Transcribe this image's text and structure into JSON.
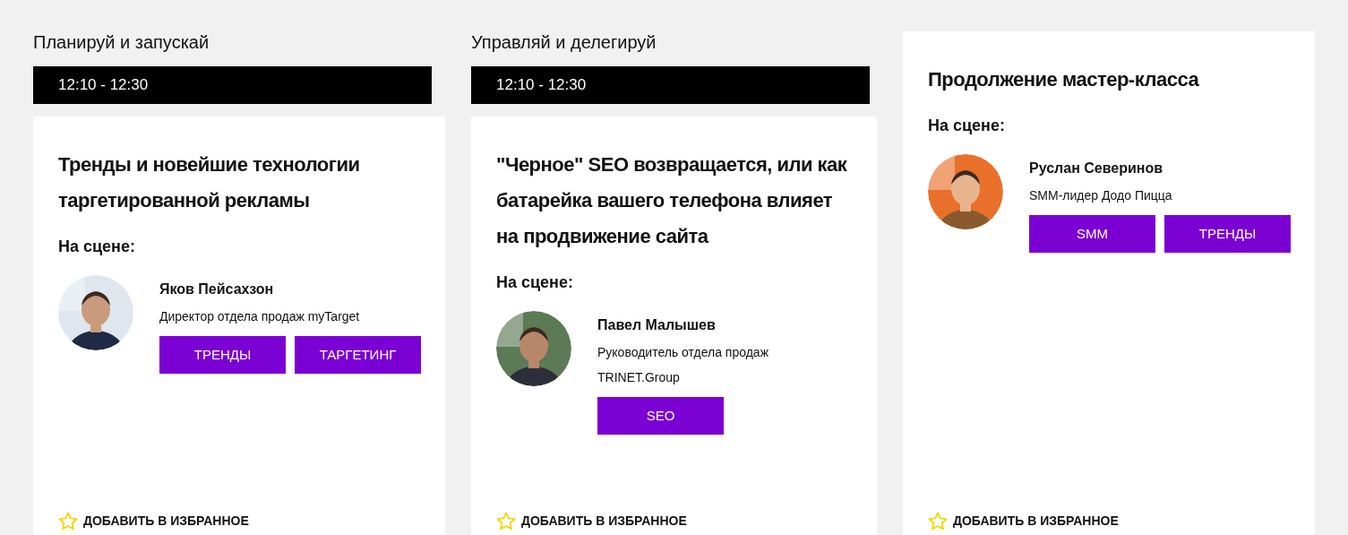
{
  "columns": [
    {
      "section": "Планируй и запускай",
      "time": "12:10 - 12:30",
      "title": "Тренды и новейшие технологии таргетированной рекламы",
      "stage_label": "На сцене:",
      "speaker": {
        "name": "Яков Пейсахзон",
        "role": "Директор отдела продаж myTarget"
      },
      "tags": [
        "ТРЕНДЫ",
        "ТАРГЕТИНГ"
      ],
      "favorite": "ДОБАВИТЬ В ИЗБРАННОЕ"
    },
    {
      "section": "Управляй и делегируй",
      "time": "12:10 - 12:30",
      "title": "\"Черное\" SEO возвращается, или как батарейка вашего телефона влияет на продвижение сайта",
      "stage_label": "На сцене:",
      "speaker": {
        "name": "Павел Малышев",
        "role": "Руководитель отдела продаж TRINET.Group"
      },
      "tags": [
        "SEO"
      ],
      "favorite": "ДОБАВИТЬ В ИЗБРАННОЕ"
    },
    {
      "title": "Продолжение мастер-класса",
      "stage_label": "На сцене:",
      "speaker": {
        "name": "Руслан Северинов",
        "role": "SMM-лидер Додо Пицца"
      },
      "tags": [
        "SMM",
        "ТРЕНДЫ"
      ],
      "favorite": "ДОБАВИТЬ В ИЗБРАННОЕ"
    }
  ]
}
